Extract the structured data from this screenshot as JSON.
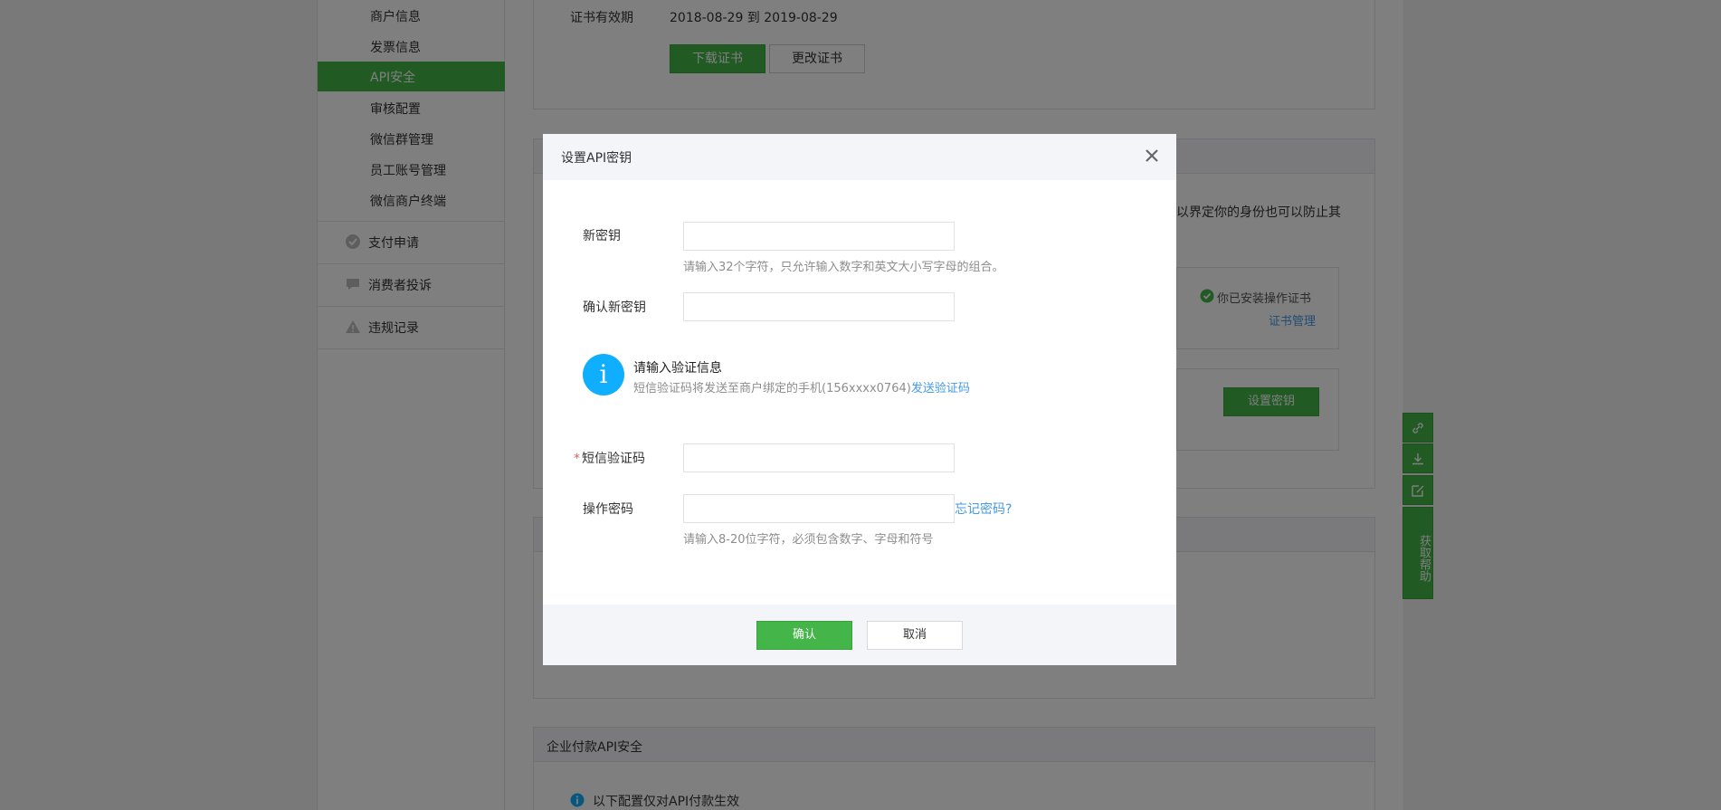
{
  "sidebar": {
    "sub_items": [
      "商户信息",
      "发票信息",
      "API安全",
      "审核配置",
      "微信群管理",
      "员工账号管理",
      "微信商户终端"
    ],
    "active_item": "API安全",
    "main_items": [
      {
        "label": "支付申请",
        "icon": "check-circle-icon"
      },
      {
        "label": "消费者投诉",
        "icon": "chat-bubble-icon"
      },
      {
        "label": "违规记录",
        "icon": "warning-icon"
      }
    ]
  },
  "certificate": {
    "label": "证书有效期",
    "date_range": "2018-08-29  到  2019-08-29",
    "download_button": "下载证书",
    "change_button": "更改证书"
  },
  "background": {
    "partial_text": "以界定你的身份也可以防止其",
    "installed_text": "你已安装操作证书",
    "manage_link": "证书管理",
    "set_key_button": "设置密钥",
    "enterprise_title": "企业付款API安全",
    "enterprise_note": "以下配置仅对API付款生效"
  },
  "float_tools": {
    "help_label": "获取帮助",
    "icons": [
      "link-icon",
      "download-icon",
      "edit-icon"
    ]
  },
  "dialog": {
    "title": "设置API密钥",
    "new_key_label": "新密钥",
    "new_key_hint": "请输入32个字符，只允许输入数字和英文大小写字母的组合。",
    "confirm_key_label": "确认新密钥",
    "info_title": "请输入验证信息",
    "info_desc": "短信验证码将发送至商户绑定的手机(156xxxx0764)",
    "send_code_link": "发送验证码",
    "sms_label": "短信验证码",
    "required_mark": "*",
    "op_password_label": "操作密码",
    "forgot_link": "忘记密码?",
    "op_password_hint": "请输入8-20位字符，必须包含数字、字母和符号",
    "ok_button": "确认",
    "cancel_button": "取消"
  },
  "colors": {
    "accent": "#44b549",
    "link": "#459ae9",
    "info": "#10aeff",
    "required": "#e15f63"
  }
}
